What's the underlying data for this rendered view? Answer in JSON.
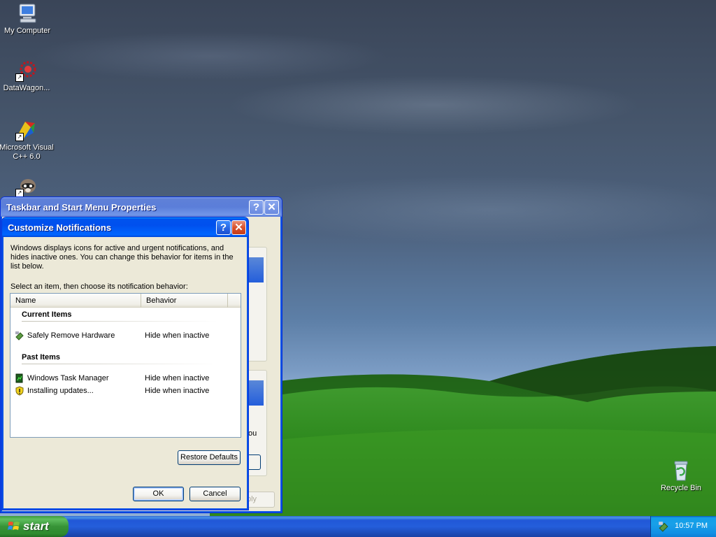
{
  "desktop": {
    "icons": [
      {
        "label": "My Computer",
        "icon": "my-computer-icon"
      },
      {
        "label": "DataWagon...",
        "icon": "datawagon-icon"
      },
      {
        "label": "Microsoft Visual C++ 6.0",
        "icon": "visual-cpp-icon"
      },
      {
        "label": "",
        "icon": "raccoon-app-icon"
      },
      {
        "label": "Recycle Bin",
        "icon": "recycle-bin-icon"
      }
    ]
  },
  "taskbar_props": {
    "title": "Taskbar and Start Menu Properties",
    "help": "?",
    "close": "✕",
    "partial_text": "ou",
    "apply_partial": "ply"
  },
  "dialog": {
    "title": "Customize Notifications",
    "help": "?",
    "close": "✕",
    "description": "Windows displays icons for active and urgent notifications, and hides inactive ones. You can change this behavior for items in the list below.",
    "instruction": "Select an item, then choose its notification behavior:",
    "columns": [
      "Name",
      "Behavior"
    ],
    "groups": [
      {
        "title": "Current Items",
        "items": [
          {
            "name": "Safely Remove Hardware",
            "behavior": "Hide when inactive",
            "icon": "safely-remove-hardware-icon"
          }
        ]
      },
      {
        "title": "Past Items",
        "items": [
          {
            "name": "Windows Task Manager",
            "behavior": "Hide when inactive",
            "icon": "task-manager-icon"
          },
          {
            "name": "Installing updates...",
            "behavior": "Hide when inactive",
            "icon": "windows-update-shield-icon"
          }
        ]
      }
    ],
    "buttons": {
      "restore": "Restore Defaults",
      "ok": "OK",
      "cancel": "Cancel"
    }
  },
  "taskbar": {
    "start_label": "start",
    "clock": "10:57 PM",
    "tray_icon": "safely-remove-hardware-icon"
  },
  "colors": {
    "xp_blue": "#0053ee",
    "start_green": "#379337",
    "window_face": "#ece9d8"
  }
}
